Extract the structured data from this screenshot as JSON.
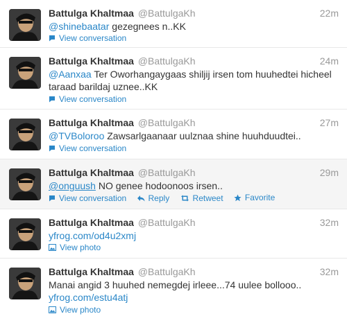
{
  "colors": {
    "link": "#2a87c8",
    "meta": "#999999",
    "hover_bg": "#f5f5f5"
  },
  "tweets": [
    {
      "name": "Battulga Khaltmaa",
      "handle": "@BattulgaKh",
      "time": "22m",
      "mention": "@shinebaatar",
      "body": " gezegnees n..KK",
      "action": "View conversation",
      "action_icon": "speech-bubble-icon"
    },
    {
      "name": "Battulga Khaltmaa",
      "handle": "@BattulgaKh",
      "time": "24m",
      "mention": "@Aanxaa",
      "body": " Ter Oworhangaygaas shiljij irsen tom huuhedtei hicheel taraad barildaj uznee..KK",
      "action": "View conversation",
      "action_icon": "speech-bubble-icon"
    },
    {
      "name": "Battulga Khaltmaa",
      "handle": "@BattulgaKh",
      "time": "27m",
      "mention": "@TVBoloroo",
      "body": " Zawsarlgaanaar uulznaa shine huuhduudtei..",
      "action": "View conversation",
      "action_icon": "speech-bubble-icon"
    },
    {
      "name": "Battulga Khaltmaa",
      "handle": "@BattulgaKh",
      "time": "29m",
      "mention": "@onguush",
      "body": " NO genee hodoonoos irsen..",
      "action": "View conversation",
      "action_icon": "speech-bubble-icon",
      "reply": "Reply",
      "retweet": "Retweet",
      "favorite": "Favorite"
    },
    {
      "name": "Battulga Khaltmaa",
      "handle": "@BattulgaKh",
      "time": "32m",
      "link": "yfrog.com/od4u2xmj",
      "action": "View photo",
      "action_icon": "photo-icon"
    },
    {
      "name": "Battulga Khaltmaa",
      "handle": "@BattulgaKh",
      "time": "32m",
      "body": "Manai angid 3 huuhed nemegdej irleee...74 uulee bollooo.. ",
      "link": "yfrog.com/estu4atj",
      "action": "View photo",
      "action_icon": "photo-icon"
    }
  ]
}
